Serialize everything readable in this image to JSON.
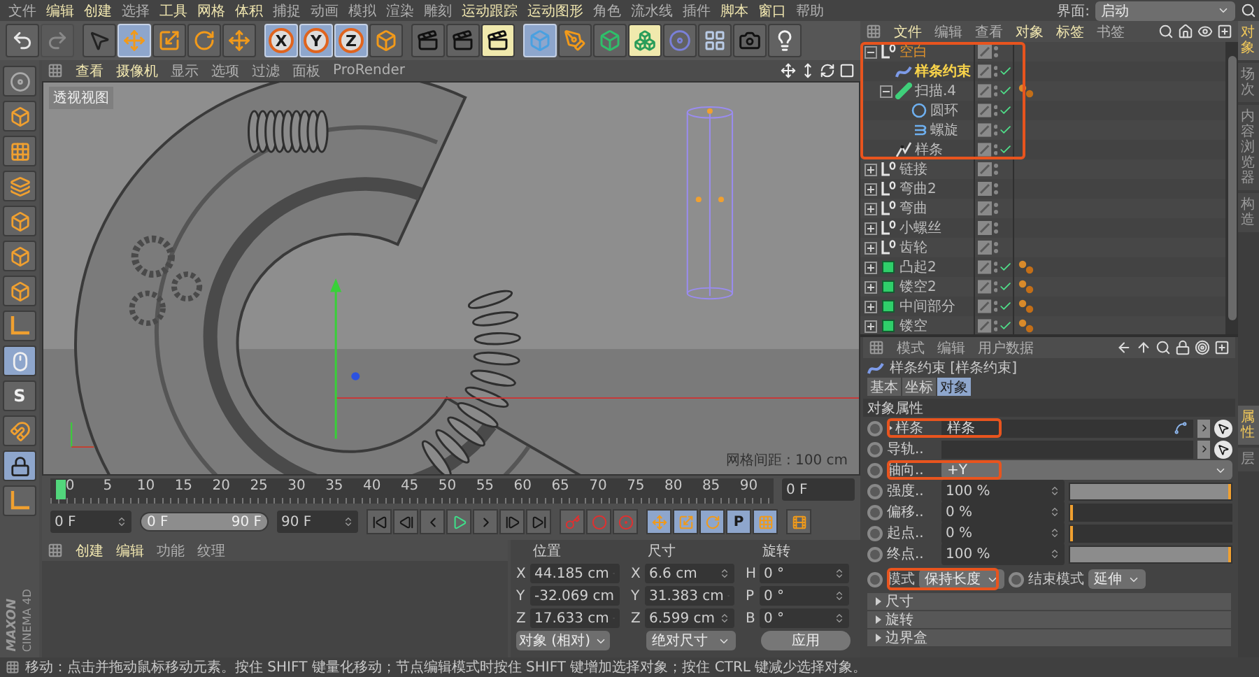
{
  "menu_bar": [
    {
      "label": "文件",
      "highlighted": false
    },
    {
      "label": "编辑",
      "highlighted": true
    },
    {
      "label": "创建",
      "highlighted": true
    },
    {
      "label": "选择",
      "highlighted": false
    },
    {
      "label": "工具",
      "highlighted": true
    },
    {
      "label": "网格",
      "highlighted": true
    },
    {
      "label": "体积",
      "highlighted": true
    },
    {
      "label": "捕捉",
      "highlighted": false
    },
    {
      "label": "动画",
      "highlighted": false
    },
    {
      "label": "模拟",
      "highlighted": false
    },
    {
      "label": "渲染",
      "highlighted": false
    },
    {
      "label": "雕刻",
      "highlighted": false
    },
    {
      "label": "运动跟踪",
      "highlighted": true
    },
    {
      "label": "运动图形",
      "highlighted": true
    },
    {
      "label": "角色",
      "highlighted": false
    },
    {
      "label": "流水线",
      "highlighted": false
    },
    {
      "label": "插件",
      "highlighted": false
    },
    {
      "label": "脚本",
      "highlighted": true
    },
    {
      "label": "窗口",
      "highlighted": true
    },
    {
      "label": "帮助",
      "highlighted": false
    }
  ],
  "layout_selector": {
    "label": "界面:",
    "value": "启动"
  },
  "toolbar": [
    [
      {
        "kind": "undo",
        "selected": false,
        "highlighted": false,
        "disabled": false
      },
      {
        "kind": "redo",
        "selected": false,
        "highlighted": false,
        "disabled": true
      }
    ],
    [
      {
        "kind": "select",
        "selected": false,
        "highlighted": false,
        "disabled": false
      },
      {
        "kind": "move",
        "selected": true,
        "highlighted": false,
        "disabled": false
      },
      {
        "kind": "scale",
        "selected": false,
        "highlighted": false,
        "disabled": false
      },
      {
        "kind": "rotate",
        "selected": false,
        "highlighted": false,
        "disabled": false
      },
      {
        "kind": "recent",
        "selected": false,
        "highlighted": false,
        "disabled": false
      }
    ],
    [
      {
        "kind": "axis",
        "label": "X",
        "selected": true,
        "highlighted": false,
        "disabled": false
      },
      {
        "kind": "axis",
        "label": "Y",
        "selected": true,
        "highlighted": false,
        "disabled": false
      },
      {
        "kind": "axis",
        "label": "Z",
        "selected": true,
        "highlighted": false,
        "disabled": false
      },
      {
        "kind": "coords",
        "selected": false,
        "highlighted": false,
        "disabled": false
      }
    ],
    [
      {
        "kind": "render-view",
        "selected": false,
        "highlighted": false,
        "disabled": false
      },
      {
        "kind": "render-viewer",
        "selected": false,
        "highlighted": false,
        "disabled": false
      },
      {
        "kind": "render-settings",
        "selected": false,
        "highlighted": true,
        "disabled": false
      }
    ],
    [
      {
        "kind": "cube",
        "selected": true,
        "highlighted": false,
        "disabled": false
      },
      {
        "kind": "pen",
        "selected": false,
        "highlighted": false,
        "disabled": false
      },
      {
        "kind": "subdivision",
        "selected": false,
        "highlighted": false,
        "disabled": false
      },
      {
        "kind": "cloner",
        "selected": false,
        "highlighted": true,
        "disabled": false
      },
      {
        "kind": "deformer",
        "selected": false,
        "highlighted": false,
        "disabled": false
      },
      {
        "kind": "floor",
        "selected": false,
        "highlighted": false,
        "disabled": false
      },
      {
        "kind": "camera",
        "selected": false,
        "highlighted": false,
        "disabled": false
      },
      {
        "kind": "light",
        "selected": false,
        "highlighted": false,
        "disabled": false
      }
    ]
  ],
  "left_tools": [
    {
      "kind": "model",
      "selected": false
    },
    {
      "kind": "object",
      "selected": false
    },
    {
      "kind": "texture",
      "selected": false
    },
    {
      "kind": "workplane",
      "selected": false
    },
    {
      "kind": "points",
      "selected": false
    },
    {
      "kind": "edges",
      "selected": false
    },
    {
      "kind": "polygons",
      "selected": false
    },
    {
      "kind": "axis",
      "selected": false
    },
    {
      "kind": "tweak",
      "selected": true
    },
    {
      "kind": "snap",
      "label": "S",
      "selected": false
    },
    {
      "kind": "magnet",
      "selected": false
    },
    {
      "kind": "workplane-lock",
      "selected": true
    },
    {
      "kind": "axis",
      "selected": false
    }
  ],
  "logo": {
    "brand": "MAXON",
    "product": "CINEMA 4D"
  },
  "viewport": {
    "menu": [
      {
        "label": "查看",
        "highlighted": true
      },
      {
        "label": "摄像机",
        "highlighted": true
      },
      {
        "label": "显示",
        "highlighted": false
      },
      {
        "label": "选项",
        "highlighted": false
      },
      {
        "label": "过滤",
        "highlighted": false
      },
      {
        "label": "面板",
        "highlighted": false
      },
      {
        "label": "ProRender",
        "highlighted": false
      }
    ],
    "view_name": "透视视图",
    "grid_spacing": "网格间距 : 100 cm"
  },
  "timeline": {
    "ticks": [
      "0",
      "5",
      "10",
      "15",
      "20",
      "25",
      "30",
      "35",
      "40",
      "45",
      "50",
      "55",
      "60",
      "65",
      "70",
      "75",
      "80",
      "85",
      "90"
    ],
    "playhead": {
      "level": 0
    },
    "current_frame": "0 F",
    "start_field": "0 F",
    "range": {
      "start": "0 F",
      "end": "90 F",
      "level": 1
    },
    "end_field": "90 F",
    "transport": [
      {
        "kind": "go-start"
      },
      {
        "kind": "prev-key"
      },
      {
        "kind": "prev-frame"
      },
      {
        "kind": "play"
      },
      {
        "kind": "next-frame"
      },
      {
        "kind": "next-key"
      },
      {
        "kind": "go-end"
      }
    ],
    "record": [
      {
        "kind": "record"
      },
      {
        "kind": "autokey"
      },
      {
        "kind": "keyframe"
      }
    ],
    "key_options": [
      {
        "kind": "move",
        "selected": true
      },
      {
        "kind": "scale",
        "selected": true
      },
      {
        "kind": "rotate",
        "selected": true
      },
      {
        "kind": "param",
        "label": "P",
        "selected": true
      },
      {
        "kind": "pla",
        "selected": true
      }
    ]
  },
  "material_manager": {
    "menu": [
      {
        "label": "创建",
        "highlighted": true
      },
      {
        "label": "编辑",
        "highlighted": true
      },
      {
        "label": "功能",
        "highlighted": false
      },
      {
        "label": "纹理",
        "highlighted": false
      }
    ]
  },
  "coordinates": {
    "headers": [
      "位置",
      "尺寸",
      "旋转"
    ],
    "rows": [
      {
        "axis": "X",
        "position": "44.185 cm",
        "size_axis": "X",
        "size": "6.6 cm",
        "rotation_axis": "H",
        "rotation": "0 °"
      },
      {
        "axis": "Y",
        "position": "-32.069 cm",
        "size_axis": "Y",
        "size": "31.383 cm",
        "rotation_axis": "P",
        "rotation": "0 °"
      },
      {
        "axis": "Z",
        "position": "17.633 cm",
        "size_axis": "Z",
        "size": "6.599 cm",
        "rotation_axis": "B",
        "rotation": "0 °"
      }
    ],
    "mode": "对象 (相对)",
    "size_mode": "绝对尺寸",
    "apply": "应用"
  },
  "object_manager": {
    "menu": [
      {
        "label": "文件",
        "highlighted": true
      },
      {
        "label": "编辑",
        "highlighted": false
      },
      {
        "label": "查看",
        "highlighted": false
      },
      {
        "label": "对象",
        "highlighted": true
      },
      {
        "label": "标签",
        "highlighted": true
      },
      {
        "label": "书签",
        "highlighted": false
      }
    ],
    "tree": [
      {
        "name": "空白",
        "kind": "null",
        "expanded": true,
        "selected": false,
        "in_selection_path": true,
        "checked": false,
        "tagged": false,
        "annotated": true,
        "children": [
          {
            "name": "样条约束",
            "kind": "spline-constraint",
            "selected": true,
            "in_selection_path": false,
            "checked": true,
            "tagged": false
          },
          {
            "name": "扫描.4",
            "kind": "sweep",
            "expanded": true,
            "selected": false,
            "in_selection_path": false,
            "checked": true,
            "tagged": true,
            "children": [
              {
                "name": "圆环",
                "kind": "circle",
                "selected": false,
                "in_selection_path": false,
                "checked": true,
                "tagged": false
              },
              {
                "name": "螺旋",
                "kind": "helix",
                "selected": false,
                "in_selection_path": false,
                "checked": true,
                "tagged": false
              }
            ]
          },
          {
            "name": "样条",
            "kind": "spline",
            "selected": false,
            "in_selection_path": false,
            "checked": true,
            "tagged": false
          }
        ]
      },
      {
        "name": "链接",
        "kind": "null",
        "expanded": false,
        "selected": false,
        "in_selection_path": false,
        "checked": false,
        "tagged": false,
        "annotated": false
      },
      {
        "name": "弯曲2",
        "kind": "null",
        "expanded": false,
        "selected": false,
        "in_selection_path": false,
        "checked": false,
        "tagged": false,
        "annotated": false
      },
      {
        "name": "弯曲",
        "kind": "null",
        "expanded": false,
        "selected": false,
        "in_selection_path": false,
        "checked": false,
        "tagged": false,
        "annotated": false
      },
      {
        "name": "小螺丝",
        "kind": "null",
        "expanded": false,
        "selected": false,
        "in_selection_path": false,
        "checked": false,
        "tagged": false,
        "annotated": false
      },
      {
        "name": "齿轮",
        "kind": "null",
        "expanded": false,
        "selected": false,
        "in_selection_path": false,
        "checked": false,
        "tagged": false,
        "annotated": false
      },
      {
        "name": "凸起2",
        "kind": "boole",
        "expanded": false,
        "selected": false,
        "in_selection_path": false,
        "checked": true,
        "tagged": true,
        "annotated": false
      },
      {
        "name": "镂空2",
        "kind": "boole",
        "expanded": false,
        "selected": false,
        "in_selection_path": false,
        "checked": true,
        "tagged": true,
        "annotated": false
      },
      {
        "name": "中间部分",
        "kind": "boole",
        "expanded": false,
        "selected": false,
        "in_selection_path": false,
        "checked": true,
        "tagged": true,
        "annotated": false
      },
      {
        "name": "镂空",
        "kind": "boole",
        "expanded": false,
        "selected": false,
        "in_selection_path": false,
        "checked": true,
        "tagged": true,
        "annotated": false
      }
    ]
  },
  "side_tabs_top": [
    {
      "label": "对象",
      "selected": true
    },
    {
      "label": "场次",
      "selected": false
    },
    {
      "label": "内容浏览器",
      "selected": false
    },
    {
      "label": "构造",
      "selected": false
    }
  ],
  "side_tabs_bottom": [
    {
      "label": "属性",
      "selected": true
    },
    {
      "label": "层",
      "selected": false
    }
  ],
  "attributes": {
    "menu": [
      "模式",
      "编辑",
      "用户数据"
    ],
    "title": "样条约束 [样条约束]",
    "tabs": [
      {
        "label": "基本",
        "selected": false
      },
      {
        "label": "坐标",
        "selected": false
      },
      {
        "label": "对象",
        "selected": true
      }
    ],
    "section": "对象属性",
    "fields": [
      {
        "kind": "link",
        "label": "样条",
        "value": "样条",
        "expandable": true,
        "annotated": true
      },
      {
        "kind": "link",
        "label": "导轨..",
        "expandable": false,
        "annotated": false
      },
      {
        "kind": "dropdown",
        "label": "轴向..",
        "value": "+Y",
        "annotated": true
      },
      {
        "kind": "slider",
        "label": "强度..",
        "value": "100 %",
        "level": 1,
        "annotated": false
      },
      {
        "kind": "slider",
        "label": "偏移..",
        "value": "0 %",
        "level": 0,
        "annotated": false
      },
      {
        "kind": "slider",
        "label": "起点..",
        "value": "0 %",
        "level": 0,
        "annotated": false
      },
      {
        "kind": "slider",
        "label": "终点..",
        "value": "100 %",
        "level": 1,
        "annotated": false
      }
    ],
    "mode_row": [
      {
        "label": "模式",
        "value": "保持长度",
        "annotated": true
      },
      {
        "label": "结束模式",
        "value": "延伸",
        "annotated": false
      }
    ],
    "groups": [
      "尺寸",
      "旋转",
      "边界盒"
    ]
  },
  "status_bar": "移动：点击并拖动鼠标移动元素。按住 SHIFT 键量化移动；节点编辑模式时按住 SHIFT 键增加选择对象；按住 CTRL 键减少选择对象。"
}
